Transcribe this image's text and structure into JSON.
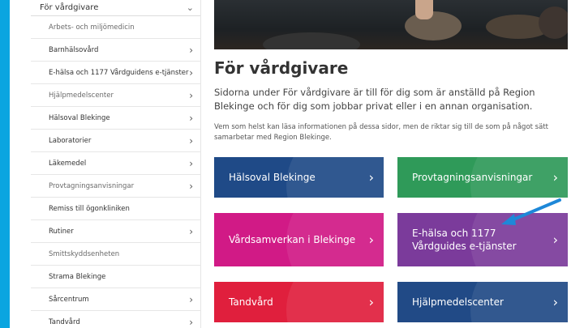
{
  "colors": {
    "rail": "#0aa5e0",
    "card_blue": "#1f4a87",
    "card_green": "#2f9a59",
    "card_pink": "#d11a86",
    "card_purple": "#7b3b9b",
    "card_red": "#e01f3d",
    "card_navy": "#214a86",
    "arrow": "#1e88d8"
  },
  "sidebar": {
    "header": {
      "label": "För vårdgivare",
      "icon": "chevron-down-icon"
    },
    "items": [
      {
        "label": "Arbets- och miljömedicin",
        "has_chevron": false
      },
      {
        "label": "Barnhälsovård",
        "has_chevron": true
      },
      {
        "label": "E-hälsa och 1177 Vårdguidens e-tjänster",
        "has_chevron": true
      },
      {
        "label": "Hjälpmedelscenter",
        "has_chevron": true
      },
      {
        "label": "Hälsoval Blekinge",
        "has_chevron": true
      },
      {
        "label": "Laboratorier",
        "has_chevron": true
      },
      {
        "label": "Läkemedel",
        "has_chevron": true
      },
      {
        "label": "Provtagningsanvisningar",
        "has_chevron": true
      },
      {
        "label": "Remiss till ögonkliniken",
        "has_chevron": false
      },
      {
        "label": "Rutiner",
        "has_chevron": true
      },
      {
        "label": "Smittskyddsenheten",
        "has_chevron": false
      },
      {
        "label": "Strama Blekinge",
        "has_chevron": false
      },
      {
        "label": "Sårcentrum",
        "has_chevron": true
      },
      {
        "label": "Tandvård",
        "has_chevron": true
      }
    ]
  },
  "main": {
    "title": "För vårdgivare",
    "lead": "Sidorna under För vårdgivare är till för dig som är anställd på Region Blekinge och för dig som jobbar privat eller i en annan organisation.",
    "note": "Vem som helst kan läsa informationen på dessa sidor, men de riktar sig till de som på något sätt samarbetar med Region Blekinge.",
    "cards": [
      {
        "label": "Hälsoval Blekinge"
      },
      {
        "label": "Provtagningsanvisningar"
      },
      {
        "label": "Vårdsamverkan i Blekinge"
      },
      {
        "label": "E-hälsa och 1177 Vårdguides e-tjänster"
      },
      {
        "label": "Tandvård"
      },
      {
        "label": "Hjälpmedelscenter"
      }
    ]
  }
}
